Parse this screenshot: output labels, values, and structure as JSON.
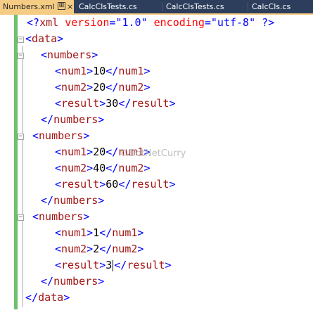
{
  "tabs": [
    {
      "label": "Numbers.xml",
      "active": true,
      "pin": "⊞",
      "close": "×"
    },
    {
      "label": "CalcClsTests.cs",
      "active": false
    },
    {
      "label": "CalcClsTests.cs",
      "active": false
    },
    {
      "label": "CalcCls.cs",
      "active": false
    }
  ],
  "code": {
    "declaration": {
      "open": "<?",
      "name": "xml",
      "attr1_name": "version",
      "attr1_value": "\"1.0\"",
      "attr2_name": "encoding",
      "attr2_value": "\"utf-8\"",
      "close": "?>"
    },
    "root_tag": "data",
    "group_tag": "numbers",
    "groups": [
      {
        "num1": "10",
        "num2": "20",
        "result": "30"
      },
      {
        "num1": "20",
        "num2": "40",
        "result": "60"
      },
      {
        "num1": "1",
        "num2": "2",
        "result": "3"
      }
    ],
    "num1_tag": "num1",
    "num2_tag": "num2",
    "result_tag": "result"
  },
  "watermark": "©DotNetCurry",
  "colors": {
    "tabstrip": "#2d3e5c",
    "active_tab": "#f5cc84",
    "change_bar": "#6dc06d",
    "tag": "#a31515",
    "bracket": "#0000ff",
    "attribute": "#ff0000",
    "text": "#000000"
  }
}
